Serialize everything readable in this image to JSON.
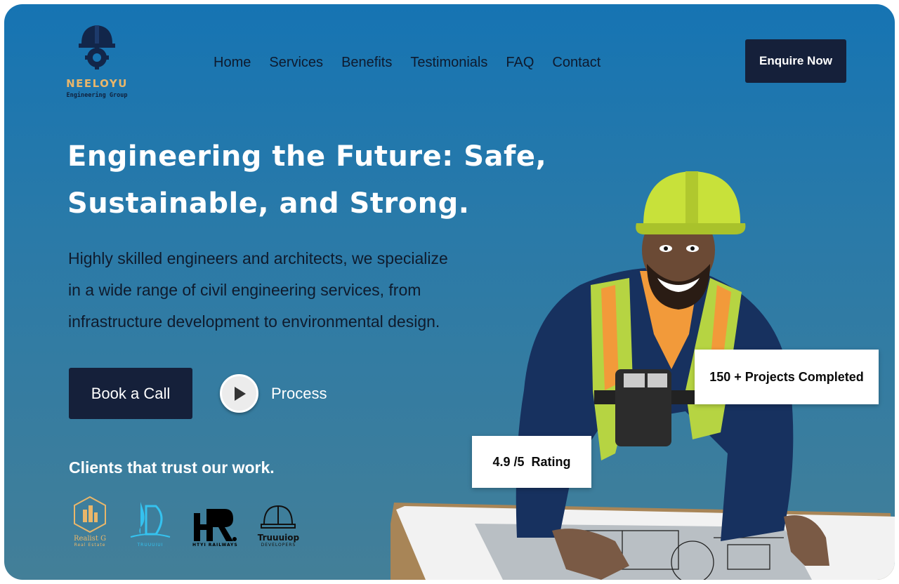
{
  "brand": {
    "name": "NEELOYU",
    "tagline": "Engineering Group",
    "icon": "helmet-gear-logo",
    "accent": "#e9b66a"
  },
  "nav": {
    "items": [
      "Home",
      "Services",
      "Benefits",
      "Testimonials",
      "FAQ",
      "Contact"
    ]
  },
  "header": {
    "cta_label": "Enquire Now"
  },
  "hero": {
    "headline_line1": "Engineering the Future: Safe,",
    "headline_line2": "Sustainable, and Strong.",
    "description_line1": "Highly skilled engineers and architects, we specialize",
    "description_line2": "in a wide range of civil engineering services, from",
    "description_line3": "infrastructure development to environmental design.",
    "primary_cta": "Book a Call",
    "secondary_cta": "Process",
    "secondary_cta_icon": "play-icon"
  },
  "clients": {
    "title": "Clients that trust our work.",
    "logos": [
      {
        "name": "Realist G",
        "sub": "Real Estate"
      },
      {
        "name": "TRUUUIUI",
        "sub": ""
      },
      {
        "name": "HR",
        "sub": "HTYI RAILWAYS"
      },
      {
        "name": "Truuuiop",
        "sub": "DEVELOPERS"
      }
    ]
  },
  "stats": {
    "projects": "150 + Projects Completed",
    "rating": "4.9 /5  Rating"
  },
  "colors": {
    "background_top": "#1674b3",
    "background_bottom": "#437f98",
    "dark_button": "#15203a"
  }
}
